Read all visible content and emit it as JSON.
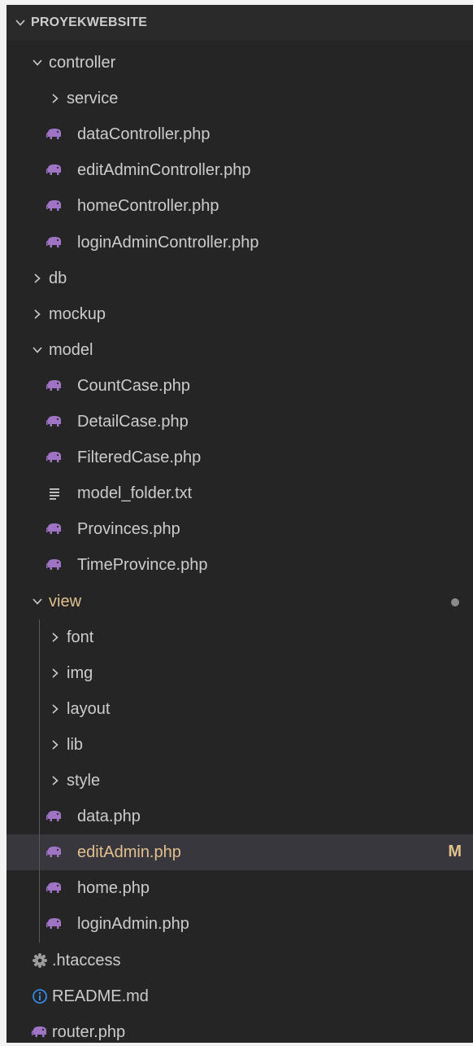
{
  "explorer": {
    "root_title": "PROYEKWEBSITE",
    "items": [
      {
        "label": "controller",
        "type": "folder",
        "expanded": true
      },
      {
        "label": "service",
        "type": "folder",
        "expanded": false
      },
      {
        "label": "dataController.php",
        "type": "php"
      },
      {
        "label": "editAdminController.php",
        "type": "php"
      },
      {
        "label": "homeController.php",
        "type": "php"
      },
      {
        "label": "loginAdminController.php",
        "type": "php"
      },
      {
        "label": "db",
        "type": "folder",
        "expanded": false
      },
      {
        "label": "mockup",
        "type": "folder",
        "expanded": false
      },
      {
        "label": "model",
        "type": "folder",
        "expanded": true
      },
      {
        "label": "CountCase.php",
        "type": "php"
      },
      {
        "label": "DetailCase.php",
        "type": "php"
      },
      {
        "label": "FilteredCase.php",
        "type": "php"
      },
      {
        "label": "model_folder.txt",
        "type": "txt"
      },
      {
        "label": "Provinces.php",
        "type": "php"
      },
      {
        "label": "TimeProvince.php",
        "type": "php"
      },
      {
        "label": "view",
        "type": "folder",
        "expanded": true,
        "status": "modified-dot"
      },
      {
        "label": "font",
        "type": "folder",
        "expanded": false
      },
      {
        "label": "img",
        "type": "folder",
        "expanded": false
      },
      {
        "label": "layout",
        "type": "folder",
        "expanded": false
      },
      {
        "label": "lib",
        "type": "folder",
        "expanded": false
      },
      {
        "label": "style",
        "type": "folder",
        "expanded": false
      },
      {
        "label": "data.php",
        "type": "php"
      },
      {
        "label": "editAdmin.php",
        "type": "php",
        "selected": true,
        "badge": "M"
      },
      {
        "label": "home.php",
        "type": "php"
      },
      {
        "label": "loginAdmin.php",
        "type": "php"
      },
      {
        "label": ".htaccess",
        "type": "config"
      },
      {
        "label": "README.md",
        "type": "info"
      },
      {
        "label": "router.php",
        "type": "php"
      }
    ]
  },
  "icons": {
    "php": "elephant-icon",
    "txt": "text-file-icon",
    "config": "gear-icon",
    "info": "info-icon",
    "folder_closed": "chevron-right-icon",
    "folder_open": "chevron-down-icon"
  },
  "colors": {
    "background": "#252526",
    "header": "#2a2a2b",
    "text": "#cccccc",
    "modified": "#e2c08d",
    "selection": "#37373d",
    "php_icon": "#a074c4",
    "info_icon": "#3794ff"
  }
}
